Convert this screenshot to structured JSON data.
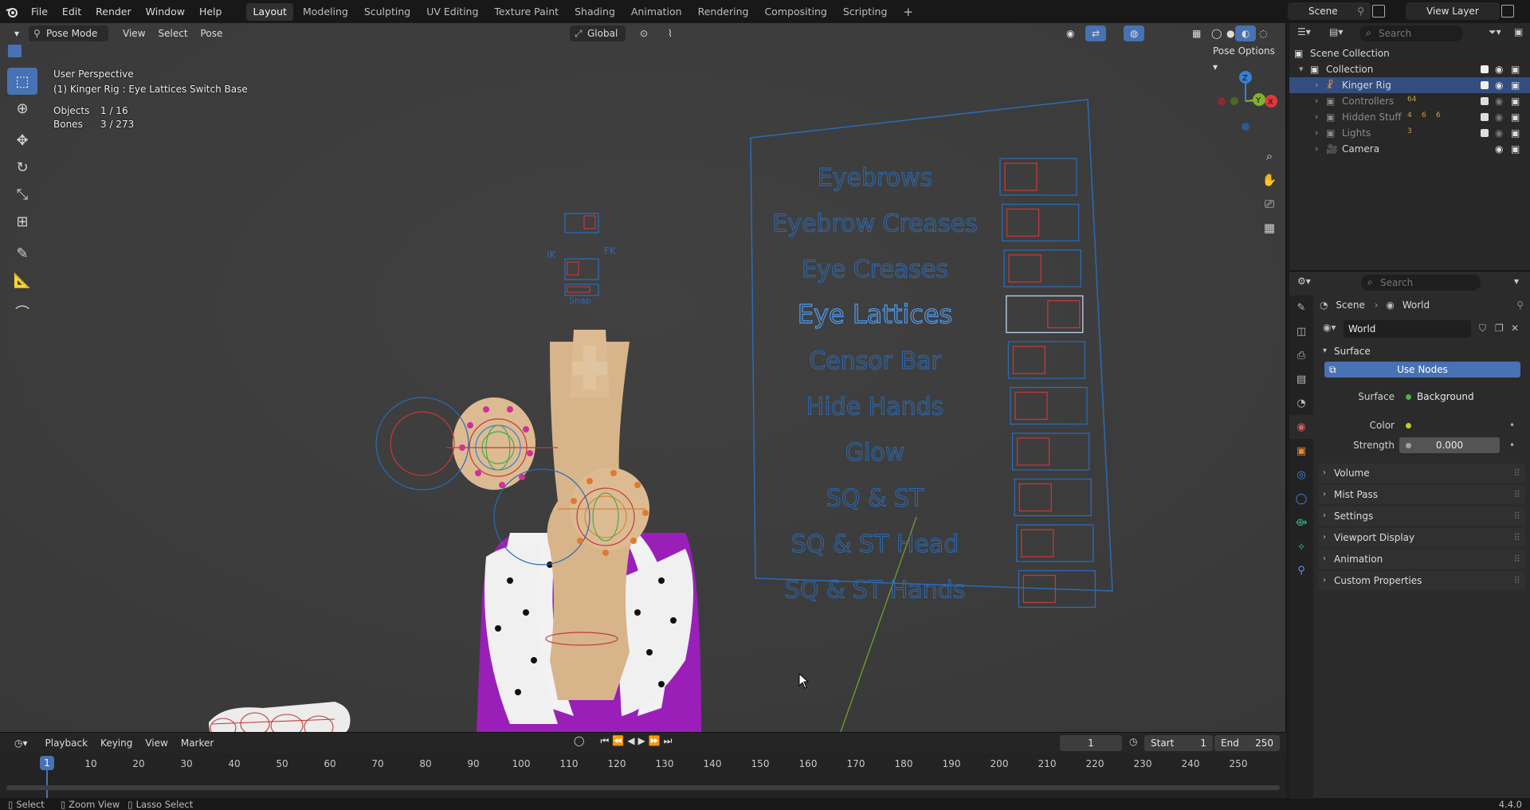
{
  "menu": {
    "file": "File",
    "edit": "Edit",
    "render": "Render",
    "window": "Window",
    "help": "Help"
  },
  "workspaces": [
    {
      "label": "Layout",
      "active": true
    },
    {
      "label": "Modeling"
    },
    {
      "label": "Sculpting"
    },
    {
      "label": "UV Editing"
    },
    {
      "label": "Texture Paint"
    },
    {
      "label": "Shading"
    },
    {
      "label": "Animation"
    },
    {
      "label": "Rendering"
    },
    {
      "label": "Compositing"
    },
    {
      "label": "Scripting"
    }
  ],
  "scene_name": "Scene",
  "view_layer": "View Layer",
  "viewport": {
    "mode": "Pose Mode",
    "menus": {
      "view": "View",
      "select": "Select",
      "pose": "Pose"
    },
    "orientation": "Global",
    "pose_options": "Pose Options",
    "info_line1": "User Perspective",
    "info_line2": "(1) Kinger Rig : Eye Lattices Switch Base",
    "objects_label": "Objects",
    "objects_value": "1 / 16",
    "bones_label": "Bones",
    "bones_value": "3 / 273",
    "gizmo": {
      "x": "X",
      "y": "Y",
      "z": "Z"
    },
    "switch_labels": [
      "Eyebrows",
      "Eyebrow Creases",
      "Eye Creases",
      "Eye Lattices",
      "Censor Bar",
      "Hide Hands",
      "Glow",
      "SQ & ST",
      "SQ & ST Head",
      "SQ & ST Hands"
    ],
    "ik_label": "IK",
    "fk_label": "FK",
    "snap_label": "Snap"
  },
  "timeline": {
    "playback": "Playback",
    "keying": "Keying",
    "view": "View",
    "marker": "Marker",
    "current_frame": "1",
    "start_label": "Start",
    "start_value": "1",
    "end_label": "End",
    "end_value": "250",
    "ticks": [
      "1",
      "10",
      "20",
      "30",
      "40",
      "50",
      "60",
      "70",
      "80",
      "90",
      "100",
      "110",
      "120",
      "130",
      "140",
      "150",
      "160",
      "170",
      "180",
      "190",
      "200",
      "210",
      "220",
      "230",
      "240",
      "250"
    ]
  },
  "statusbar": {
    "select": "Select",
    "zoom": "Zoom View",
    "lasso": "Lasso Select",
    "version": "4.4.0"
  },
  "outliner": {
    "search_placeholder": "Search",
    "rows": [
      {
        "label": "Scene Collection"
      },
      {
        "label": "Collection"
      },
      {
        "label": "Kinger Rig"
      },
      {
        "label": "Controllers",
        "badge": "64"
      },
      {
        "label": "Hidden Stuff",
        "badge": "4",
        "badge2": "6",
        "badge3": "6"
      },
      {
        "label": "Lights",
        "badge": "3"
      },
      {
        "label": "Camera"
      }
    ]
  },
  "properties": {
    "search_placeholder": "Search",
    "breadcrumb_scene": "Scene",
    "breadcrumb_world": "World",
    "world_name": "World",
    "surface_panel": "Surface",
    "use_nodes": "Use Nodes",
    "surface_label": "Surface",
    "surface_value": "Background",
    "color_label": "Color",
    "strength_label": "Strength",
    "strength_value": "0.000",
    "panels": [
      "Volume",
      "Mist Pass",
      "Settings",
      "Viewport Display",
      "Animation",
      "Custom Properties"
    ]
  }
}
